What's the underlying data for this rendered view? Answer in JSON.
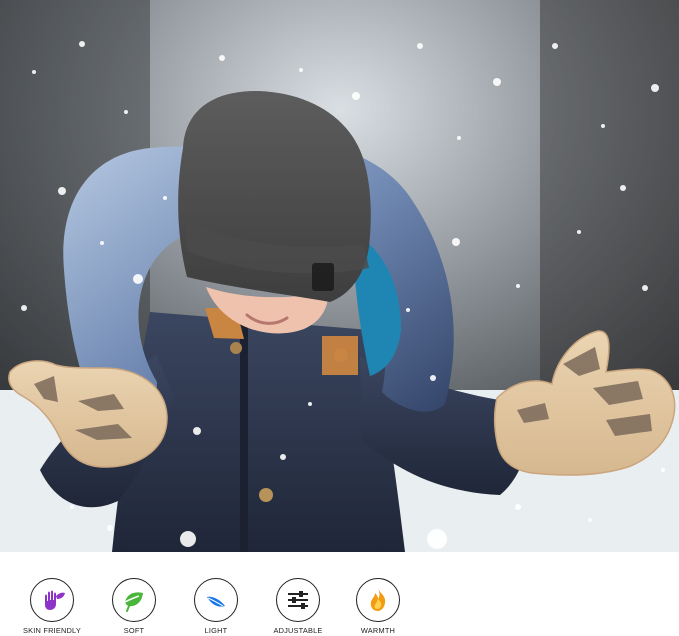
{
  "hero": {
    "subject": "child in winter outfit throwing snow"
  },
  "features": [
    {
      "id": "skin-friendly",
      "label": "SKIN FRIENDLY",
      "icon": "hand-leaf-icon",
      "color": "#8e33c8"
    },
    {
      "id": "soft",
      "label": "SOFT",
      "icon": "leaf-icon",
      "color": "#49b53a"
    },
    {
      "id": "light",
      "label": "LIGHT",
      "icon": "feather-icon",
      "color": "#1976e8"
    },
    {
      "id": "adjustable",
      "label": "ADJUSTABLE",
      "icon": "sliders-icon",
      "color": "#222222"
    },
    {
      "id": "warmth",
      "label": "WARMTH",
      "icon": "flame-icon",
      "color": "#f39c12"
    }
  ]
}
